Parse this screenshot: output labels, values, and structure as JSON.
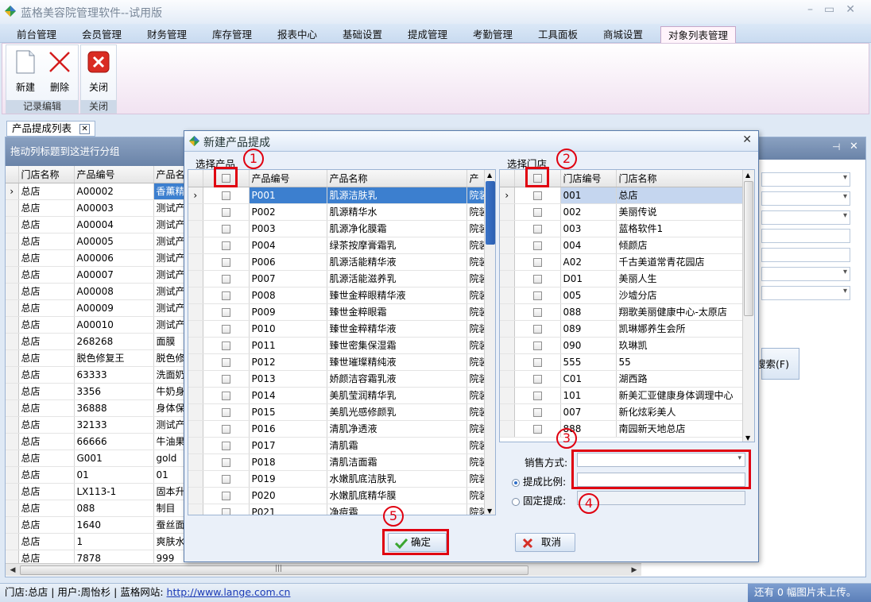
{
  "app": {
    "title": "蓝格美容院管理软件--试用版",
    "window_controls": [
      "–",
      "▭",
      "✕"
    ]
  },
  "menu": {
    "items": [
      "前台管理",
      "会员管理",
      "财务管理",
      "库存管理",
      "报表中心",
      "基础设置",
      "提成管理",
      "考勤管理",
      "工具面板",
      "商城设置",
      "对象列表管理"
    ],
    "active_index": 10
  },
  "ribbon": {
    "groups": [
      {
        "label": "记录编辑",
        "buttons": [
          {
            "label": "新建",
            "icon": "new-document-icon"
          },
          {
            "label": "删除",
            "icon": "delete-x-icon"
          }
        ]
      },
      {
        "label": "关闭",
        "buttons": [
          {
            "label": "关闭",
            "icon": "close-red-icon"
          }
        ]
      }
    ]
  },
  "doc_tab": {
    "label": "产品提成列表",
    "close": "✕"
  },
  "background_grid": {
    "group_hint": "拖动列标题到这进行分组",
    "columns": [
      "门店名称",
      "产品编号",
      "产品名"
    ],
    "rows": [
      [
        "总店",
        "A00002",
        "香薰精"
      ],
      [
        "总店",
        "A00003",
        "测试产"
      ],
      [
        "总店",
        "A00004",
        "测试产"
      ],
      [
        "总店",
        "A00005",
        "测试产"
      ],
      [
        "总店",
        "A00006",
        "测试产"
      ],
      [
        "总店",
        "A00007",
        "测试产"
      ],
      [
        "总店",
        "A00008",
        "测试产"
      ],
      [
        "总店",
        "A00009",
        "测试产"
      ],
      [
        "总店",
        "A00010",
        "测试产"
      ],
      [
        "总店",
        "268268",
        "面膜"
      ],
      [
        "总店",
        "脱色修复王",
        "脱色修"
      ],
      [
        "总店",
        "63333",
        "洗面奶"
      ],
      [
        "总店",
        "3356",
        "牛奶身"
      ],
      [
        "总店",
        "36888",
        "身体保"
      ],
      [
        "总店",
        "32133",
        "测试产"
      ],
      [
        "总店",
        "66666",
        "牛油果"
      ],
      [
        "总店",
        "G001",
        "gold"
      ],
      [
        "总店",
        "01",
        "01"
      ],
      [
        "总店",
        "LX113-1",
        "固本升"
      ],
      [
        "总店",
        "088",
        "制目"
      ],
      [
        "总店",
        "1640",
        "蚕丝面"
      ],
      [
        "总店",
        "1",
        "爽肤水"
      ],
      [
        "总店",
        "7878",
        "999"
      ]
    ],
    "selected_row": 0,
    "search_button": "搜索(F)"
  },
  "dialog": {
    "title": "新建产品提成",
    "close": "✕",
    "products": {
      "section_label": "选择产品",
      "columns": [
        "产品编号",
        "产品名称",
        "产"
      ],
      "rows": [
        [
          "P001",
          "肌源洁肤乳",
          "院装"
        ],
        [
          "P002",
          "肌源精华水",
          "院装"
        ],
        [
          "P003",
          "肌源净化膜霜",
          "院装"
        ],
        [
          "P004",
          "绿茶按摩膏霜乳",
          "院装"
        ],
        [
          "P006",
          "肌源活能精华液",
          "院装"
        ],
        [
          "P007",
          "肌源活能滋养乳",
          "院装"
        ],
        [
          "P008",
          "臻世金粹眼精华液",
          "院装"
        ],
        [
          "P009",
          "臻世金粹眼霜",
          "院装"
        ],
        [
          "P010",
          "臻世金粹精华液",
          "院装"
        ],
        [
          "P011",
          "臻世密集保湿霜",
          "院装"
        ],
        [
          "P012",
          "臻世璀璨精纯液",
          "院装"
        ],
        [
          "P013",
          "娇颜洁容霜乳液",
          "院装"
        ],
        [
          "P014",
          "美肌莹润精华乳",
          "院装"
        ],
        [
          "P015",
          "美肌光感修颜乳",
          "院装"
        ],
        [
          "P016",
          "清肌净透液",
          "院装"
        ],
        [
          "P017",
          "清肌霜",
          "院装"
        ],
        [
          "P018",
          "清肌洁面霜",
          "院装"
        ],
        [
          "P019",
          "水嫩肌底洁肤乳",
          "院装"
        ],
        [
          "P020",
          "水嫩肌底精华膜",
          "院装"
        ],
        [
          "P021",
          "净痘霜",
          "院装"
        ]
      ]
    },
    "stores": {
      "section_label": "选择门店",
      "columns": [
        "门店编号",
        "门店名称"
      ],
      "rows": [
        [
          "001",
          "总店"
        ],
        [
          "002",
          "美丽传说"
        ],
        [
          "003",
          "蓝格软件1"
        ],
        [
          "004",
          "倾颜店"
        ],
        [
          "A02",
          "千古美道常青花园店"
        ],
        [
          "D01",
          "美丽人生"
        ],
        [
          "005",
          "沙墟分店"
        ],
        [
          "088",
          "翔歌美丽健康中心-太原店"
        ],
        [
          "089",
          "凯琳娜养生会所"
        ],
        [
          "090",
          "玖琳凯"
        ],
        [
          "555",
          "55"
        ],
        [
          "C01",
          "湖西路"
        ],
        [
          "101",
          "新美汇亚健康身体调理中心"
        ],
        [
          "007",
          "新化炫彩美人"
        ],
        [
          "888",
          "南园新天地总店"
        ]
      ]
    },
    "form": {
      "sale_mode_label": "销售方式:",
      "ratio_label": "提成比例:",
      "fixed_label": "固定提成:",
      "ratio_selected": true
    },
    "ok_button": "确定",
    "cancel_button": "取消",
    "annotations": [
      "1",
      "2",
      "3",
      "4",
      "5"
    ]
  },
  "status": {
    "store_label": "门店:",
    "store": "总店",
    "sep1": "|",
    "user_label": "用户:",
    "user": "周怡杉",
    "sep2": "|",
    "site_label": "蓝格网站:",
    "site_url": "http://www.lange.com.cn",
    "upload_status": "还有 0 幅图片未上传。"
  },
  "colors": {
    "selection": "#3c7fcf",
    "annotation_red": "#e00010",
    "accent_pink": "#f1e3f1"
  }
}
